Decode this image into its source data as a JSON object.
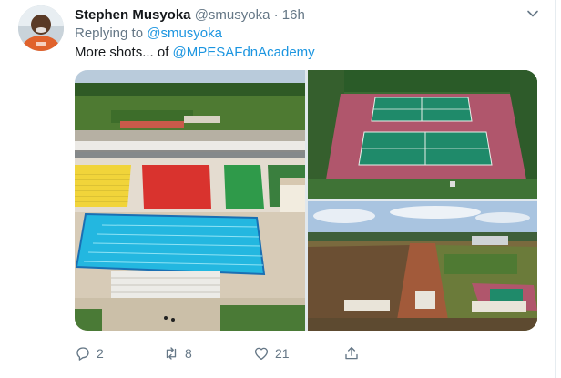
{
  "tweet": {
    "author_name": "Stephen Musyoka",
    "author_handle": "@smusyoka",
    "separator": "·",
    "time": "16h",
    "replying_to_label": "Replying to",
    "replying_to_handle": "@smusyoka",
    "text": "More shots... of",
    "mention": "@MPESAFdnAcademy"
  },
  "actions": {
    "reply_count": "2",
    "retweet_count": "8",
    "like_count": "21"
  },
  "icons": {
    "menu": "chevron-down-icon",
    "reply": "reply-icon",
    "retweet": "retweet-icon",
    "like": "heart-icon",
    "share": "share-icon"
  },
  "colors": {
    "link": "#1b95e0",
    "muted": "#657786"
  }
}
